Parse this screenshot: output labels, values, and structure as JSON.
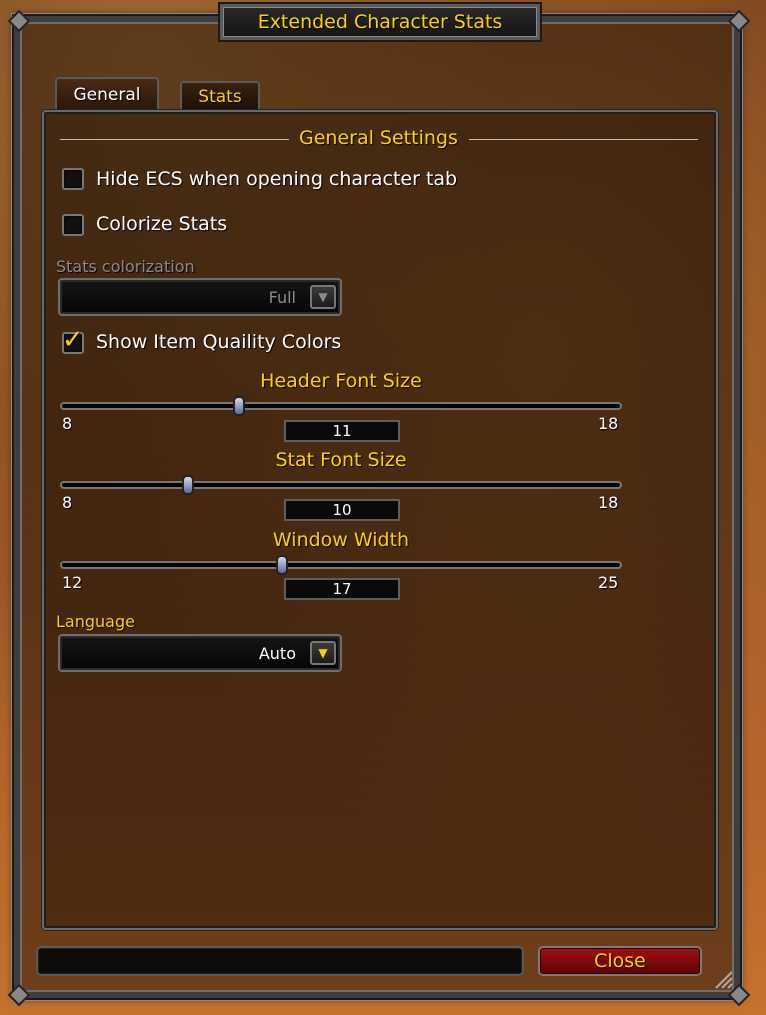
{
  "window": {
    "title": "Extended Character Stats"
  },
  "tabs": [
    {
      "label": "General",
      "selected": true
    },
    {
      "label": "Stats",
      "selected": false
    }
  ],
  "general": {
    "section_title": "General Settings",
    "hide_ecs": {
      "label": "Hide ECS when opening character tab",
      "checked": false
    },
    "colorize_stats": {
      "label": "Colorize Stats",
      "checked": false
    },
    "stats_colorization": {
      "label": "Stats colorization",
      "value": "Full",
      "enabled": false
    },
    "show_item_quality": {
      "label": "Show Item Quaility Colors",
      "checked": true
    },
    "sliders": [
      {
        "title": "Header Font Size",
        "min": "8",
        "max": "18",
        "value": "11"
      },
      {
        "title": "Stat Font Size",
        "min": "8",
        "max": "18",
        "value": "10"
      },
      {
        "title": "Window Width",
        "min": "12",
        "max": "25",
        "value": "17"
      }
    ],
    "language": {
      "label": "Language",
      "value": "Auto"
    }
  },
  "footer": {
    "close_label": "Close"
  },
  "colors": {
    "gold": "#ffd100",
    "close_red": "#a01010",
    "disabled_gray": "#8a8a8a"
  },
  "icons": {
    "dropdown_arrow": "arrow-down-icon",
    "checkmark": "checkmark-icon",
    "resize": "resize-grip-icon"
  }
}
